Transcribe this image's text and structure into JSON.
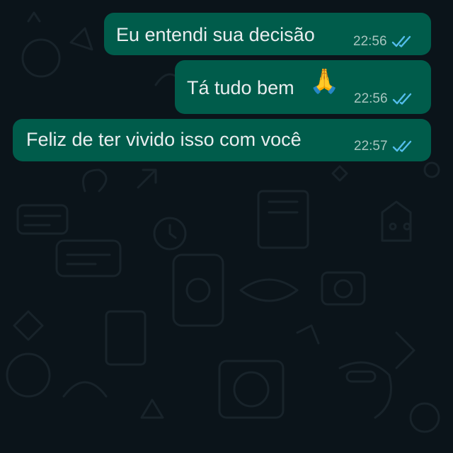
{
  "chat": {
    "messages": [
      {
        "text": "Eu entendi sua decisão",
        "emoji": "",
        "time": "22:56",
        "status_icon": "double-check-read-icon"
      },
      {
        "text": "Tá tudo bem ",
        "emoji": "🙏",
        "time": "22:56",
        "status_icon": "double-check-read-icon"
      },
      {
        "text": "Feliz de ter vivido isso com você",
        "emoji": "",
        "time": "22:57",
        "status_icon": "double-check-read-icon"
      }
    ]
  },
  "colors": {
    "background": "#0b141a",
    "outgoing_bubble": "#005c4b",
    "read_ticks": "#53bdeb",
    "message_text": "#e9edef",
    "timestamp": "#a8c5bf"
  }
}
